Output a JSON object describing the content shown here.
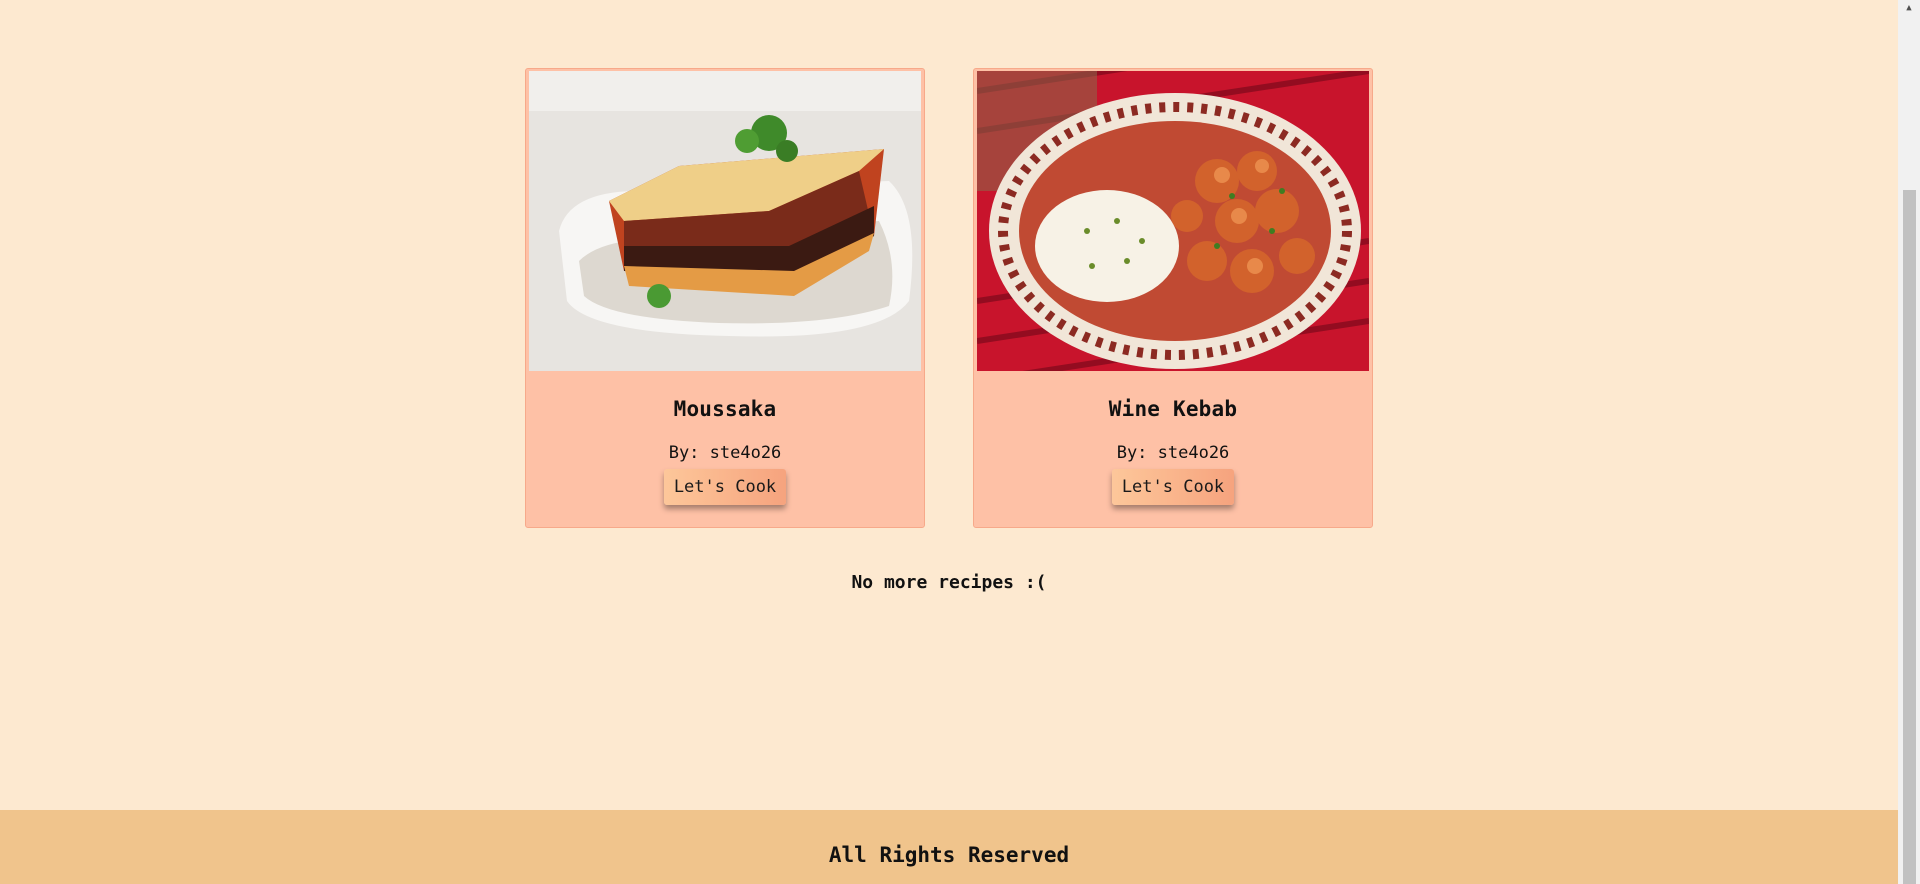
{
  "recipes": [
    {
      "title": "Moussaka",
      "author": "By: ste4o26",
      "button": "Let's Cook",
      "image": "moussaka-photo"
    },
    {
      "title": "Wine Kebab",
      "author": "By: ste4o26",
      "button": "Let's Cook",
      "image": "wine-kebab-photo"
    }
  ],
  "status": {
    "no_more": "No more recipes :("
  },
  "footer": {
    "text": "All Rights Reserved"
  },
  "colors": {
    "page_background": "#fde9d0",
    "card_background": "#fec1a6",
    "footer_background": "#f0c48c",
    "button_gradient_start": "#fdc79a",
    "button_gradient_end": "#f6a37e"
  },
  "icons": {
    "scroll_up": "triangle-up-icon"
  }
}
